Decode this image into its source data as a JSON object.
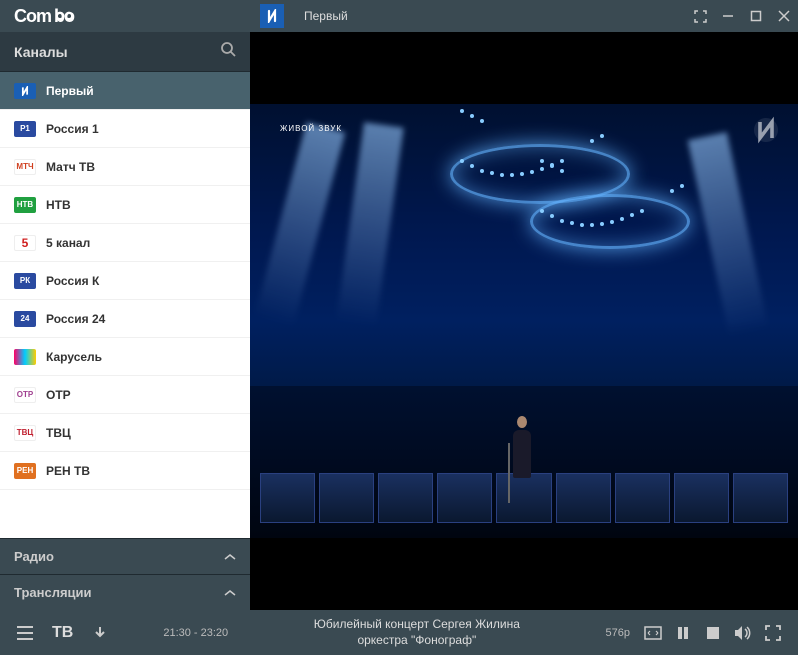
{
  "app": {
    "name": "ComboPlayer"
  },
  "titlebar": {
    "current_channel": "Первый"
  },
  "sidebar": {
    "header": "Каналы",
    "sections": {
      "radio": "Радио",
      "broadcasts": "Трансляции"
    },
    "channels": [
      {
        "name": "Первый",
        "color": "#1a5fb4",
        "active": true
      },
      {
        "name": "Россия 1",
        "color": "#2a4aa0",
        "active": false
      },
      {
        "name": "Матч ТВ",
        "color": "#d04020",
        "active": false
      },
      {
        "name": "НТВ",
        "color": "#20a040",
        "active": false
      },
      {
        "name": "5 канал",
        "color": "#d02020",
        "active": false
      },
      {
        "name": "Россия К",
        "color": "#2a4aa0",
        "active": false
      },
      {
        "name": "Россия 24",
        "color": "#2a4aa0",
        "active": false
      },
      {
        "name": "Карусель",
        "color": "#40b0c0",
        "active": false
      },
      {
        "name": "ОТР",
        "color": "#a04090",
        "active": false
      },
      {
        "name": "ТВЦ",
        "color": "#c02030",
        "active": false
      },
      {
        "name": "РЕН ТВ",
        "color": "#e07020",
        "active": false
      }
    ]
  },
  "video": {
    "live_badge": "ЖИВОЙ ЗВУК"
  },
  "bottombar": {
    "mode": "ТВ",
    "time_range": "21:30 - 23:20",
    "program_title_line1": "Юбилейный концерт Сергея Жилина",
    "program_title_line2": "оркестра \"Фонограф\"",
    "quality": "576p"
  }
}
